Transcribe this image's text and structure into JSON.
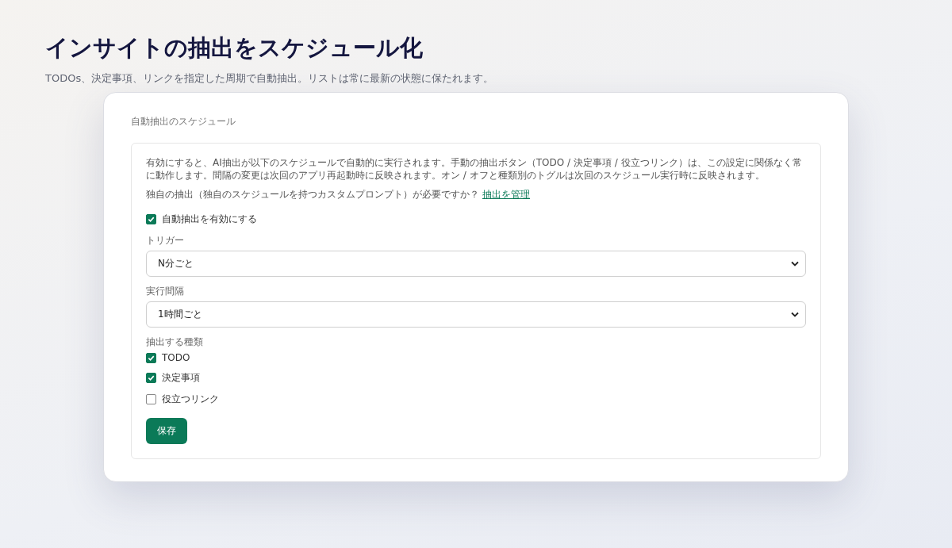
{
  "page": {
    "title": "インサイトの抽出をスケジュール化",
    "subtitle": "TODOs、決定事項、リンクを指定した周期で自動抽出。リストは常に最新の状態に保たれます。"
  },
  "card": {
    "title": "自動抽出のスケジュール",
    "description": "有効にすると、AI抽出が以下のスケジュールで自動的に実行されます。手動の抽出ボタン（TODO / 決定事項 / 役立つリンク）は、この設定に関係なく常に動作します。間隔の変更は次回のアプリ再起動時に反映されます。オン / オフと種類別のトグルは次回のスケジュール実行時に反映されます。",
    "custom_prompt": {
      "text": "独自の抽出（独自のスケジュールを持つカスタムプロンプト）が必要ですか？",
      "link": "抽出を管理"
    },
    "enable": {
      "label": "自動抽出を有効にする",
      "checked": true
    },
    "fields": [
      {
        "label": "トリガー",
        "value": "N分ごと"
      },
      {
        "label": "実行間隔",
        "value": "1時間ごと"
      }
    ],
    "types_label": "抽出する種類",
    "types": [
      {
        "label": "TODO",
        "checked": true
      },
      {
        "label": "決定事項",
        "checked": true
      },
      {
        "label": "役立つリンク",
        "checked": false
      }
    ],
    "save_button": "保存"
  }
}
